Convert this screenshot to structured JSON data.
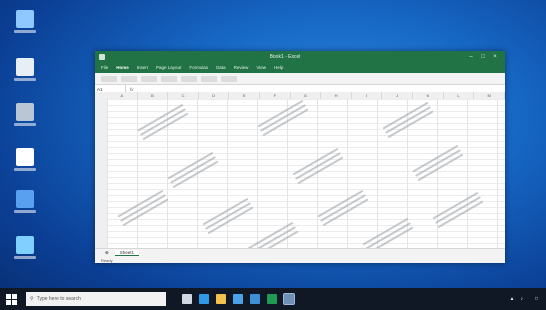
{
  "desktop": {
    "icons": [
      {
        "name": "this-pc-icon",
        "color": "#8fc8ff"
      },
      {
        "name": "folder-icon",
        "color": "#e8eef6"
      },
      {
        "name": "recycle-bin-icon",
        "color": "#b9c6d6"
      },
      {
        "name": "document-icon",
        "color": "#ffffff"
      },
      {
        "name": "shortcut-icon",
        "color": "#5aa0f0"
      },
      {
        "name": "app-icon",
        "color": "#7fd0ff"
      }
    ]
  },
  "excel": {
    "title": "Book1 - Excel",
    "accent": "#217346",
    "tabs": [
      "File",
      "Home",
      "Insert",
      "Page Layout",
      "Formulas",
      "Data",
      "Review",
      "View",
      "Help"
    ],
    "namebox": "A1",
    "fx": "fx",
    "columns": [
      "A",
      "B",
      "C",
      "D",
      "E",
      "F",
      "G",
      "H",
      "I",
      "J",
      "K",
      "L",
      "M"
    ],
    "sheet_tab": "Sheet1",
    "status": "Ready"
  },
  "taskbar": {
    "search_placeholder": "Type here to search",
    "apps": [
      {
        "name": "task-view-icon",
        "color": "#cfd8e3"
      },
      {
        "name": "edge-icon",
        "color": "#2f9be6"
      },
      {
        "name": "file-explorer-icon",
        "color": "#f2c14e"
      },
      {
        "name": "store-icon",
        "color": "#4aa3e8"
      },
      {
        "name": "mail-icon",
        "color": "#3d8fd6"
      },
      {
        "name": "excel-taskbar-icon",
        "color": "#1f9b55"
      },
      {
        "name": "app-taskbar-icon",
        "color": "#6e8fb6"
      }
    ],
    "time": "",
    "date": ""
  }
}
